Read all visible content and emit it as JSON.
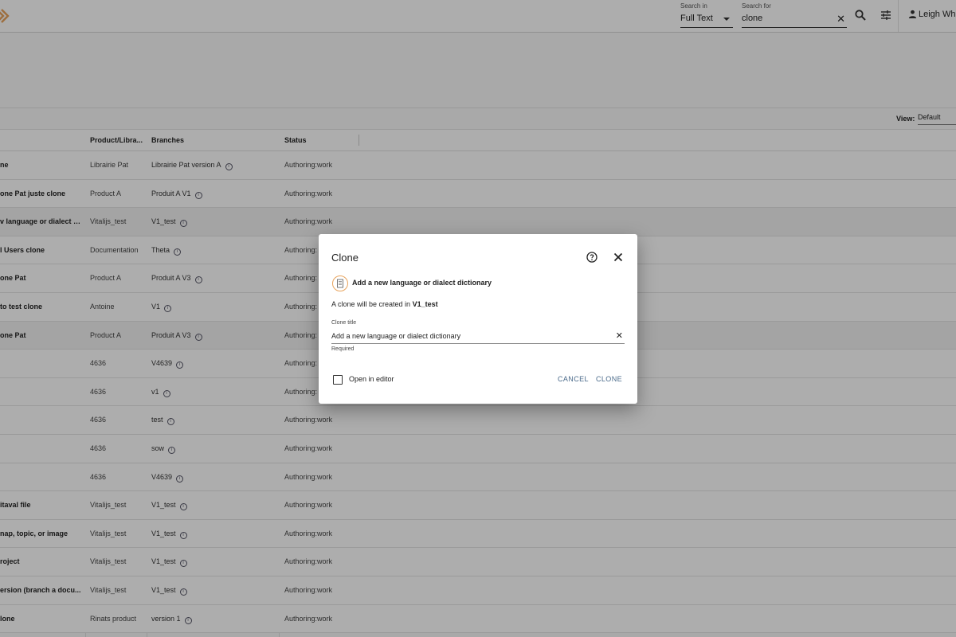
{
  "header": {
    "search_in_label": "Search in",
    "search_in_value": "Full Text",
    "search_for_label": "Search for",
    "search_for_value": "clone",
    "clear_symbol": "✕",
    "user_name": "Leigh Whi"
  },
  "toolbar": {
    "view_label": "View:",
    "view_value": "Default"
  },
  "table": {
    "columns": [
      "Product/Libra...",
      "Branches",
      "Status"
    ],
    "rows": [
      {
        "title": "ne",
        "product": "Librairie Pat",
        "branch": "Librairie Pat version A",
        "status": "Authoring:work"
      },
      {
        "title": "one Pat juste clone",
        "product": "Product A",
        "branch": "Produit A V1",
        "status": "Authoring:work"
      },
      {
        "title": "v language or dialect d...",
        "product": "Vitalijs_test",
        "branch": "V1_test",
        "status": "Authoring:work"
      },
      {
        "title": "l Users clone",
        "product": "Documentation",
        "branch": "Theta",
        "status": "Authoring:"
      },
      {
        "title": "one Pat",
        "product": "Product A",
        "branch": "Produit A V3",
        "status": "Authoring:"
      },
      {
        "title": "to test clone",
        "product": "Antoine",
        "branch": "V1",
        "status": "Authoring:"
      },
      {
        "title": "one Pat",
        "product": "Product A",
        "branch": "Produit A V3",
        "status": "Authoring:"
      },
      {
        "title": "",
        "product": "4636",
        "branch": "V4639",
        "status": "Authoring:"
      },
      {
        "title": "",
        "product": "4636",
        "branch": "v1",
        "status": "Authoring:"
      },
      {
        "title": "",
        "product": "4636",
        "branch": "test",
        "status": "Authoring:work"
      },
      {
        "title": "",
        "product": "4636",
        "branch": "sow",
        "status": "Authoring:work"
      },
      {
        "title": "",
        "product": "4636",
        "branch": "V4639",
        "status": "Authoring:work"
      },
      {
        "title": "itaval file",
        "product": "Vitalijs_test",
        "branch": "V1_test",
        "status": "Authoring:work"
      },
      {
        "title": "nap, topic, or image",
        "product": "Vitalijs_test",
        "branch": "V1_test",
        "status": "Authoring:work"
      },
      {
        "title": "roject",
        "product": "Vitalijs_test",
        "branch": "V1_test",
        "status": "Authoring:work"
      },
      {
        "title": "ersion (branch a docu...",
        "product": "Vitalijs_test",
        "branch": "V1_test",
        "status": "Authoring:work"
      },
      {
        "title": "lone",
        "product": "Rinats product",
        "branch": "version 1",
        "status": "Authoring:work"
      }
    ]
  },
  "dialog": {
    "title": "Clone",
    "template_name": "Add a new language or dialect dictionary",
    "info_prefix": "A clone will be created in ",
    "info_branch": "V1_test",
    "clone_title_label": "Clone title",
    "clone_title_value": "Add a new language or dialect dictionary",
    "clear_symbol": "✕",
    "required_text": "Required",
    "open_in_editor_label": "Open in editor",
    "cancel_label": "CANCEL",
    "clone_label": "CLONE"
  },
  "colors": {
    "accent_orange": "#e8a35c",
    "button_text": "#4a6a8a"
  }
}
